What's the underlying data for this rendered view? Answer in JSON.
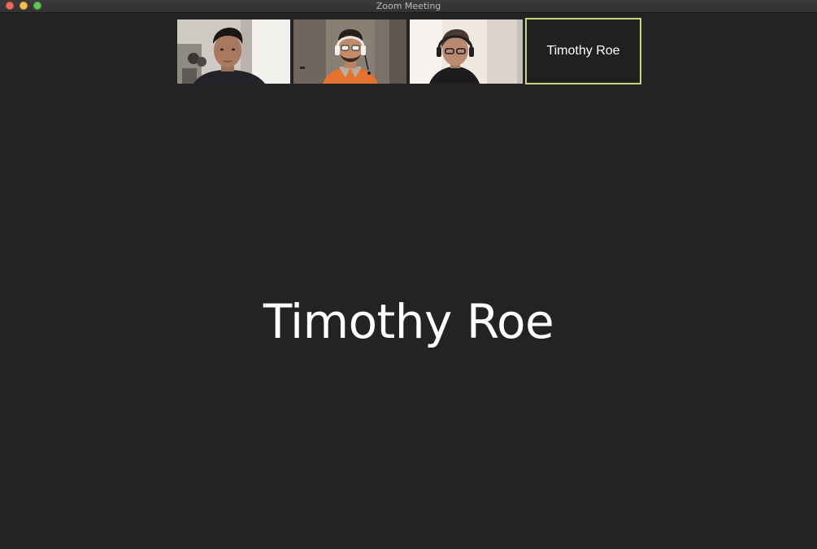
{
  "window": {
    "title": "Zoom Meeting"
  },
  "participants": {
    "video_tiles": [
      {
        "icon": "participant-video-1"
      },
      {
        "icon": "participant-video-2"
      },
      {
        "icon": "participant-video-3"
      }
    ],
    "name_tile": {
      "name": "Timothy Roe",
      "highlight_color": "#c4d97e"
    }
  },
  "active_speaker": {
    "name": "Timothy Roe"
  },
  "colors": {
    "background": "#232323",
    "close": "#ec6a5e",
    "minimize": "#f4bf4f",
    "maximize": "#61c554"
  }
}
